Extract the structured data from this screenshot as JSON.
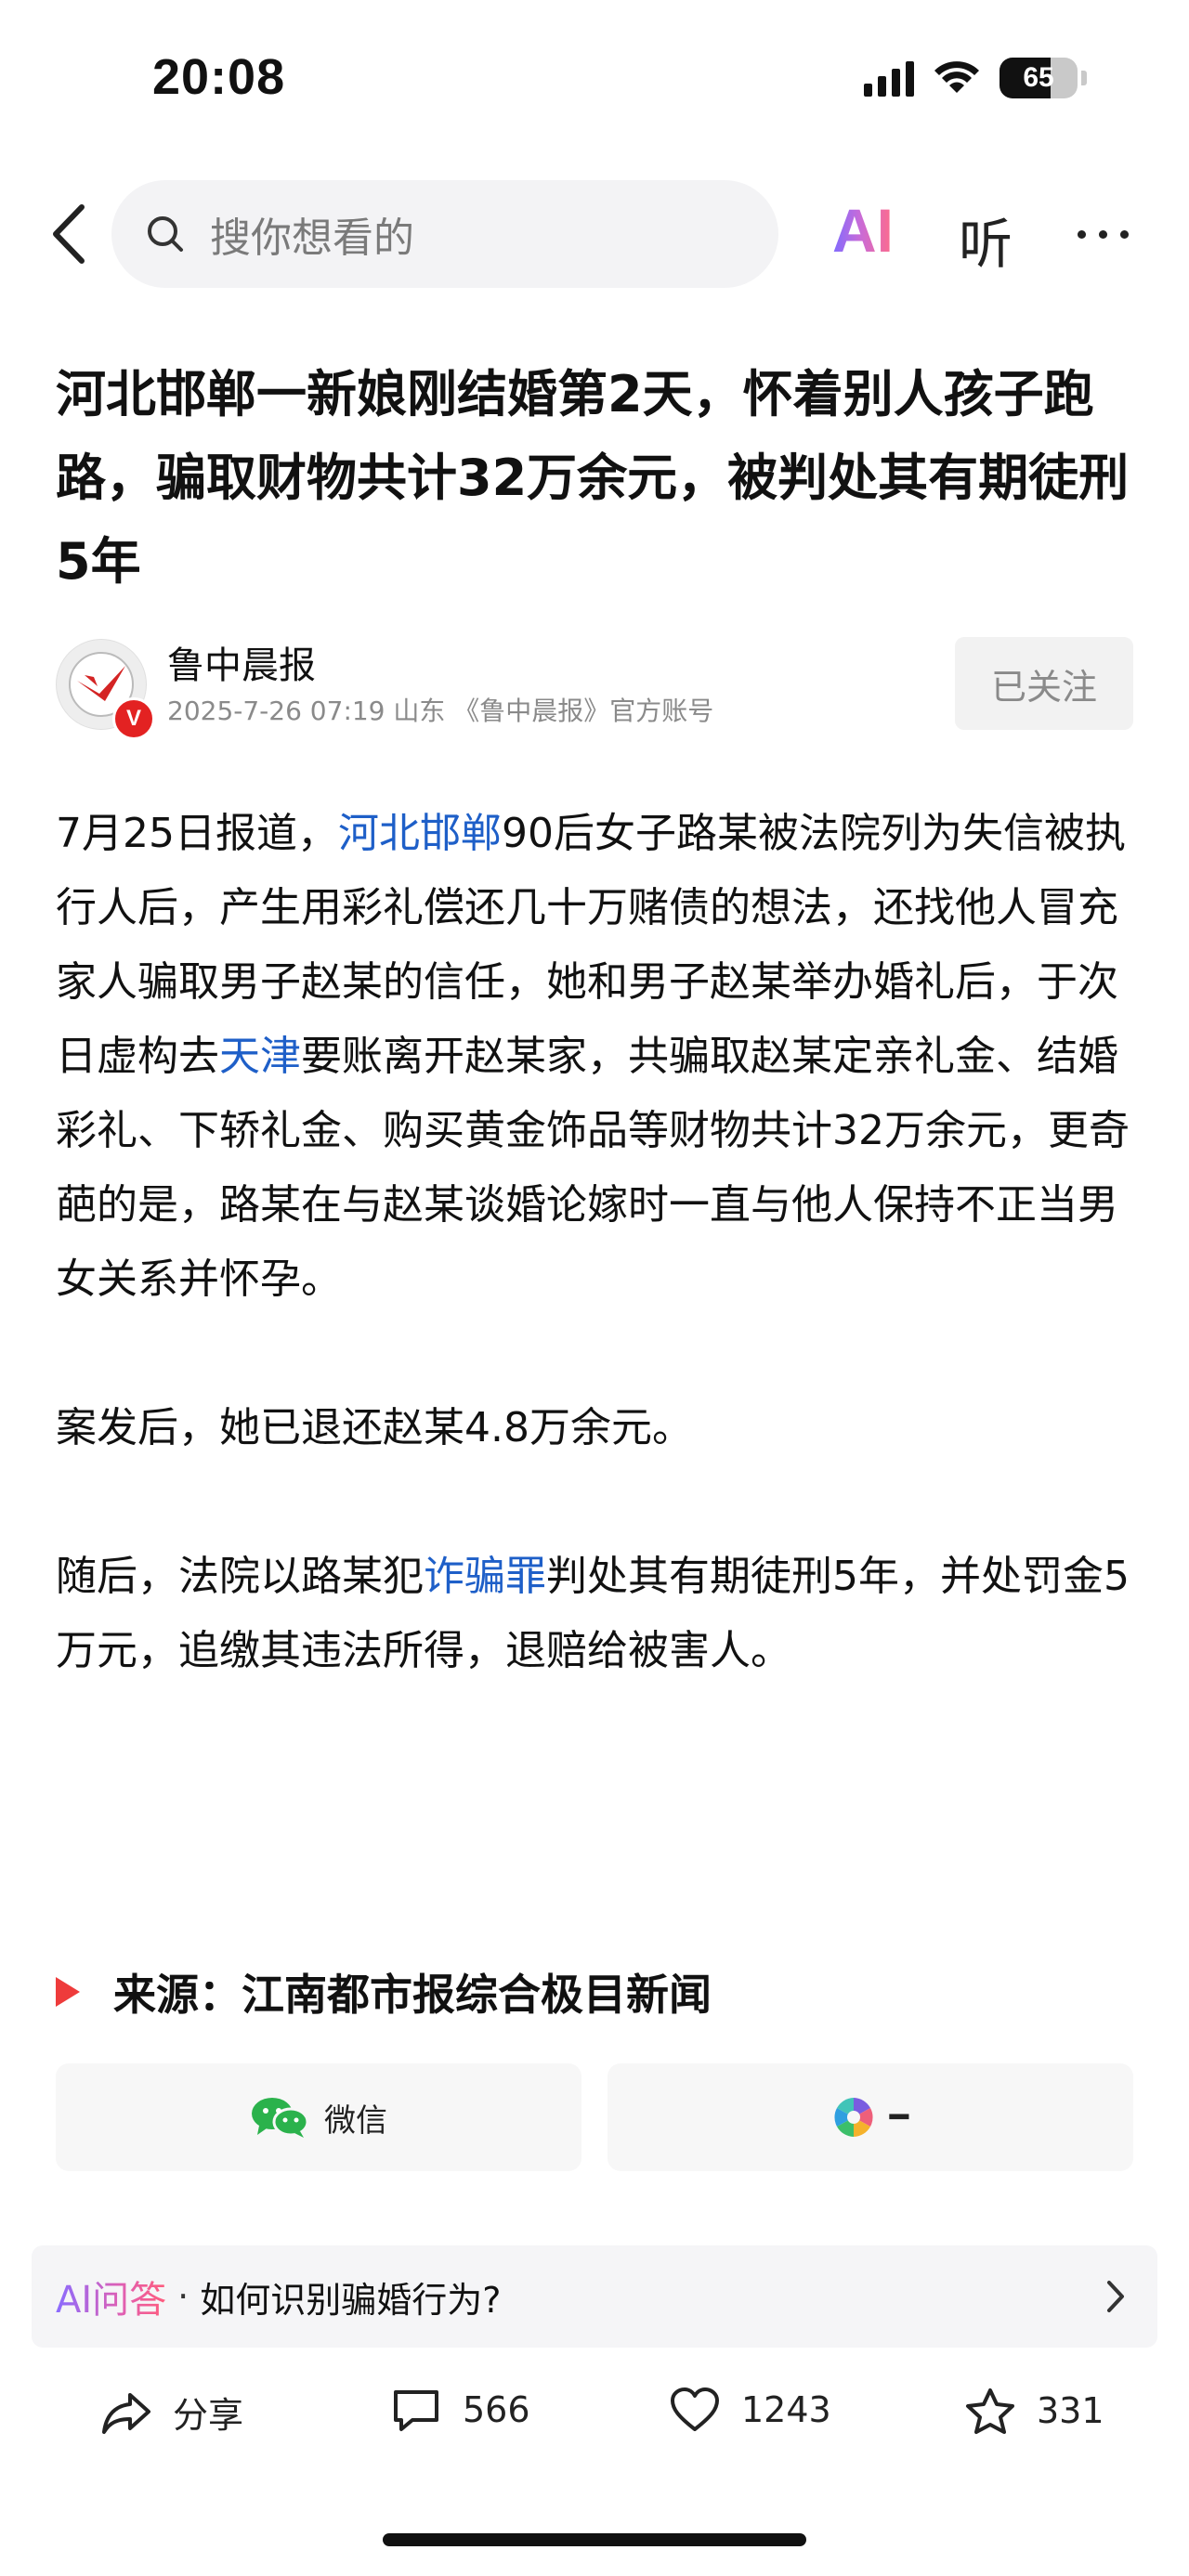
{
  "status_bar": {
    "time": "20:08",
    "battery": "65"
  },
  "nav": {
    "search_placeholder": "搜你想看的",
    "ai_label": "AI",
    "listen_label": "听"
  },
  "article": {
    "title": "河北邯郸一新娘刚结婚第2天，怀着别人孩子跑路，骗取财物共计32万余元，被判处其有期徒刑5年",
    "author": {
      "name": "鲁中晨报",
      "meta": "2025-7-26  07:19  山东  《鲁中晨报》官方账号",
      "verified_mark": "V",
      "follow_label": "已关注"
    },
    "paragraph1": {
      "part1": "7月25日报道，",
      "link1": "河北邯郸",
      "part2": "90后女子路某被法院列为失信被执行人后，产生用彩礼偿还几十万赌债的想法，还找他人冒充家人骗取男子赵某的信任，她和男子赵某举办婚礼后，于次日虚构去",
      "link2": "天津",
      "part3": "要账离开赵某家，共骗取赵某定亲礼金、结婚彩礼、下轿礼金、购买黄金饰品等财物共计32万余元，更奇葩的是，路某在与赵某谈婚论嫁时一直与他人保持不正当男女关系并怀孕。"
    },
    "paragraph2": "案发后，她已退还赵某4.8万余元。",
    "paragraph3": {
      "part1": "随后，法院以路某犯",
      "link1": "诈骗罪",
      "part2": "判处其有期徒刑5年，并处罚金5万元，追缴其违法所得，退赔给被害人。"
    },
    "source": "来源：江南都市报综合极目新闻"
  },
  "share": {
    "wechat_label": "微信",
    "moments_label": "━"
  },
  "ai_qa": {
    "label": "AI问答",
    "dot": "·",
    "question": "如何识别骗婚行为?"
  },
  "actions": {
    "share_label": "分享",
    "comments": "566",
    "likes": "1243",
    "favorites": "331"
  },
  "colors": {
    "link": "#1e5fc8",
    "accent_red": "#ee3b3b",
    "wechat_green": "#2bb24c"
  }
}
